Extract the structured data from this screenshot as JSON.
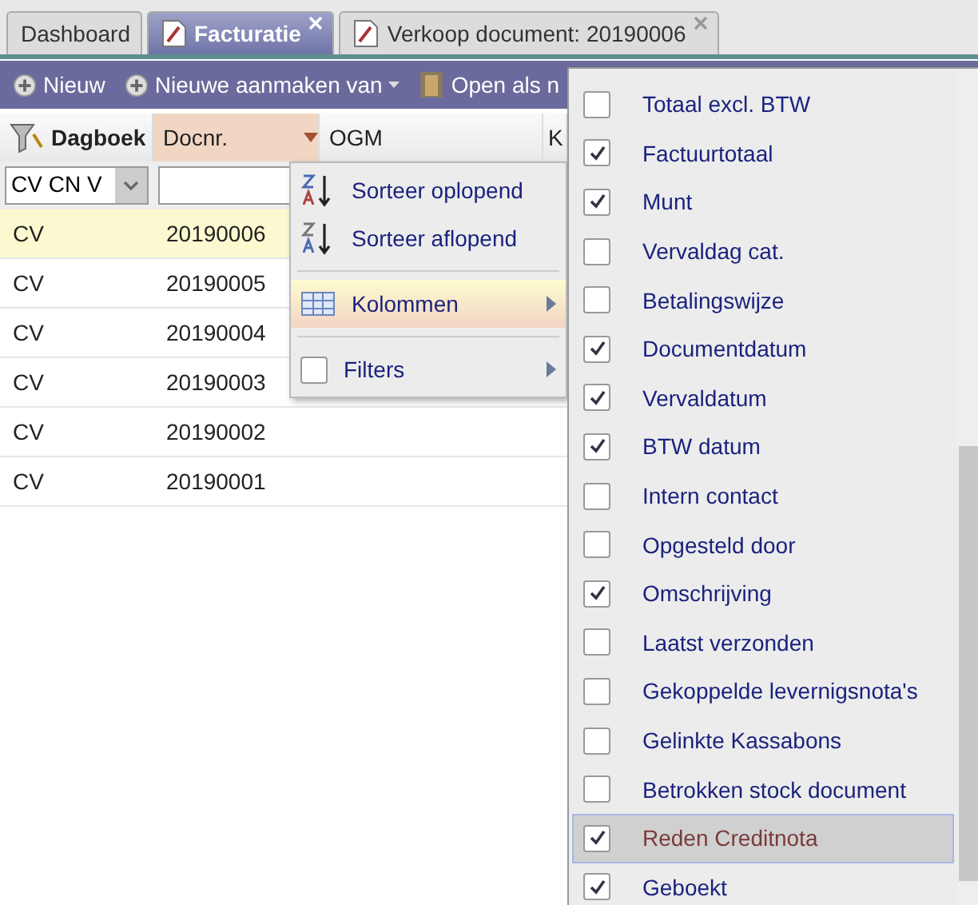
{
  "tabs": [
    {
      "label": "Dashboard",
      "selected": false,
      "kind": "plain",
      "closable": false
    },
    {
      "label": "Facturatie",
      "selected": true,
      "kind": "document",
      "closable": true
    },
    {
      "label": "Verkoop document: 20190006",
      "selected": false,
      "kind": "document",
      "closable": true
    }
  ],
  "toolbar": [
    {
      "label": "Nieuw",
      "kind": "add"
    },
    {
      "label": "Nieuwe aanmaken van",
      "kind": "add-dropdown"
    },
    {
      "label": "Open als n",
      "kind": "open"
    }
  ],
  "table": {
    "columns": [
      {
        "label": "Dagboek",
        "kind": "filter",
        "selected": false
      },
      {
        "label": "Docnr.",
        "kind": "plain",
        "selected": true
      },
      {
        "label": "OGM",
        "kind": "plain",
        "selected": false
      },
      {
        "label": "K",
        "kind": "plain",
        "selected": false
      }
    ],
    "filters": {
      "dagboek": "CV CN V"
    },
    "rows": [
      {
        "dagboek": "CV",
        "docnr": "20190006",
        "selected": true
      },
      {
        "dagboek": "CV",
        "docnr": "20190005",
        "selected": false
      },
      {
        "dagboek": "CV",
        "docnr": "20190004",
        "selected": false
      },
      {
        "dagboek": "CV",
        "docnr": "20190003",
        "selected": false
      },
      {
        "dagboek": "CV",
        "docnr": "20190002",
        "selected": false
      },
      {
        "dagboek": "CV",
        "docnr": "20190001",
        "selected": false
      }
    ]
  },
  "column_menu": [
    {
      "label": "Sorteer oplopend",
      "kind": "sort-asc",
      "selected": false
    },
    {
      "label": "Sorteer aflopend",
      "kind": "sort-desc",
      "selected": false
    },
    {
      "label": "Kolommen",
      "kind": "submenu",
      "selected": true
    },
    {
      "label": "Filters",
      "kind": "check-submenu",
      "checked": false,
      "selected": false
    }
  ],
  "columns_submenu": [
    {
      "label": "Totaal excl. BTW",
      "checked": false,
      "selected": false
    },
    {
      "label": "Factuurtotaal",
      "checked": true,
      "selected": false
    },
    {
      "label": "Munt",
      "checked": true,
      "selected": false
    },
    {
      "label": "Vervaldag cat.",
      "checked": false,
      "selected": false
    },
    {
      "label": "Betalingswijze",
      "checked": false,
      "selected": false
    },
    {
      "label": "Documentdatum",
      "checked": true,
      "selected": false
    },
    {
      "label": "Vervaldatum",
      "checked": true,
      "selected": false
    },
    {
      "label": "BTW datum",
      "checked": true,
      "selected": false
    },
    {
      "label": "Intern contact",
      "checked": false,
      "selected": false
    },
    {
      "label": "Opgesteld door",
      "checked": false,
      "selected": false
    },
    {
      "label": "Omschrijving",
      "checked": true,
      "selected": false
    },
    {
      "label": "Laatst verzonden",
      "checked": false,
      "selected": false
    },
    {
      "label": "Gekoppelde levernigsnota's",
      "checked": false,
      "selected": false
    },
    {
      "label": "Gelinkte Kassabons",
      "checked": false,
      "selected": false
    },
    {
      "label": "Betrokken stock document",
      "checked": false,
      "selected": false
    },
    {
      "label": "Reden Creditnota",
      "checked": true,
      "selected": true
    },
    {
      "label": "Geboekt",
      "checked": true,
      "selected": false
    }
  ]
}
